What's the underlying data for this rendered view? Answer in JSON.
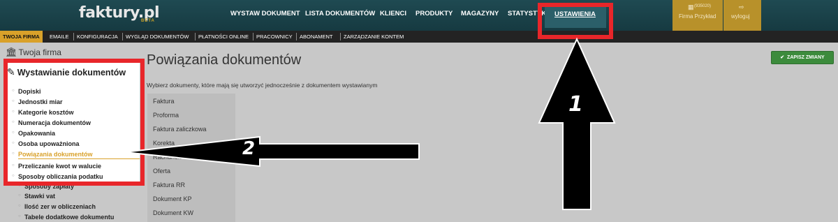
{
  "logo": {
    "text": "faktury.pl",
    "badge": "BETA"
  },
  "nav": {
    "items": [
      "WYSTAW DOKUMENT",
      "LISTA DOKUMENTÓW",
      "KLIENCI",
      "PRODUKTY",
      "MAGAZYNY",
      "STATYSTYKI"
    ],
    "active": "USTAWIENIA"
  },
  "company": {
    "code": "(935020)",
    "name": "Firma Przykład"
  },
  "logout": {
    "label": "wyloguj"
  },
  "subnav": {
    "items": [
      "TWOJA FIRMA",
      "EMAILE",
      "KONFIGURACJA",
      "WYGLĄD DOKUMENTÓW",
      "PŁATNOŚCI ONLINE",
      "PRACOWNICY",
      "ABONAMENT",
      "ZARZĄDZANIE KONTEM"
    ]
  },
  "sidebar": {
    "section1": "Twoja firma",
    "section2": "Wystawianie dokumentów",
    "items": [
      "Dopiski",
      "Jednostki miar",
      "Kategorie kosztów",
      "Numeracja dokumentów",
      "Opakowania",
      "Osoba upoważniona",
      "Powiązania dokumentów",
      "Przeliczanie kwot w walucie",
      "Sposoby obliczania podatku",
      "Sposoby zapłaty",
      "Stawki vat",
      "Ilość zer w obliczeniach",
      "Tabele dodatkowe dokumentu"
    ]
  },
  "main": {
    "title": "Powiązania dokumentów",
    "save_label": "ZAPISZ ZMIANY",
    "subtitle": "Wybierz dokumenty, które mają się utworzyć jednocześnie z dokumentem wystawianym",
    "documents": [
      "Faktura",
      "Proforma",
      "Faktura zaliczkowa",
      "Korekta",
      "Rachunek",
      "Oferta",
      "Faktura RR",
      "Dokument KP",
      "Dokument KW"
    ]
  },
  "annotations": {
    "label1": "1",
    "label2": "2"
  },
  "colors": {
    "header": "#1f4a52",
    "gold": "#d9a12a",
    "red": "#e8262a",
    "green": "#3c8b3c"
  }
}
